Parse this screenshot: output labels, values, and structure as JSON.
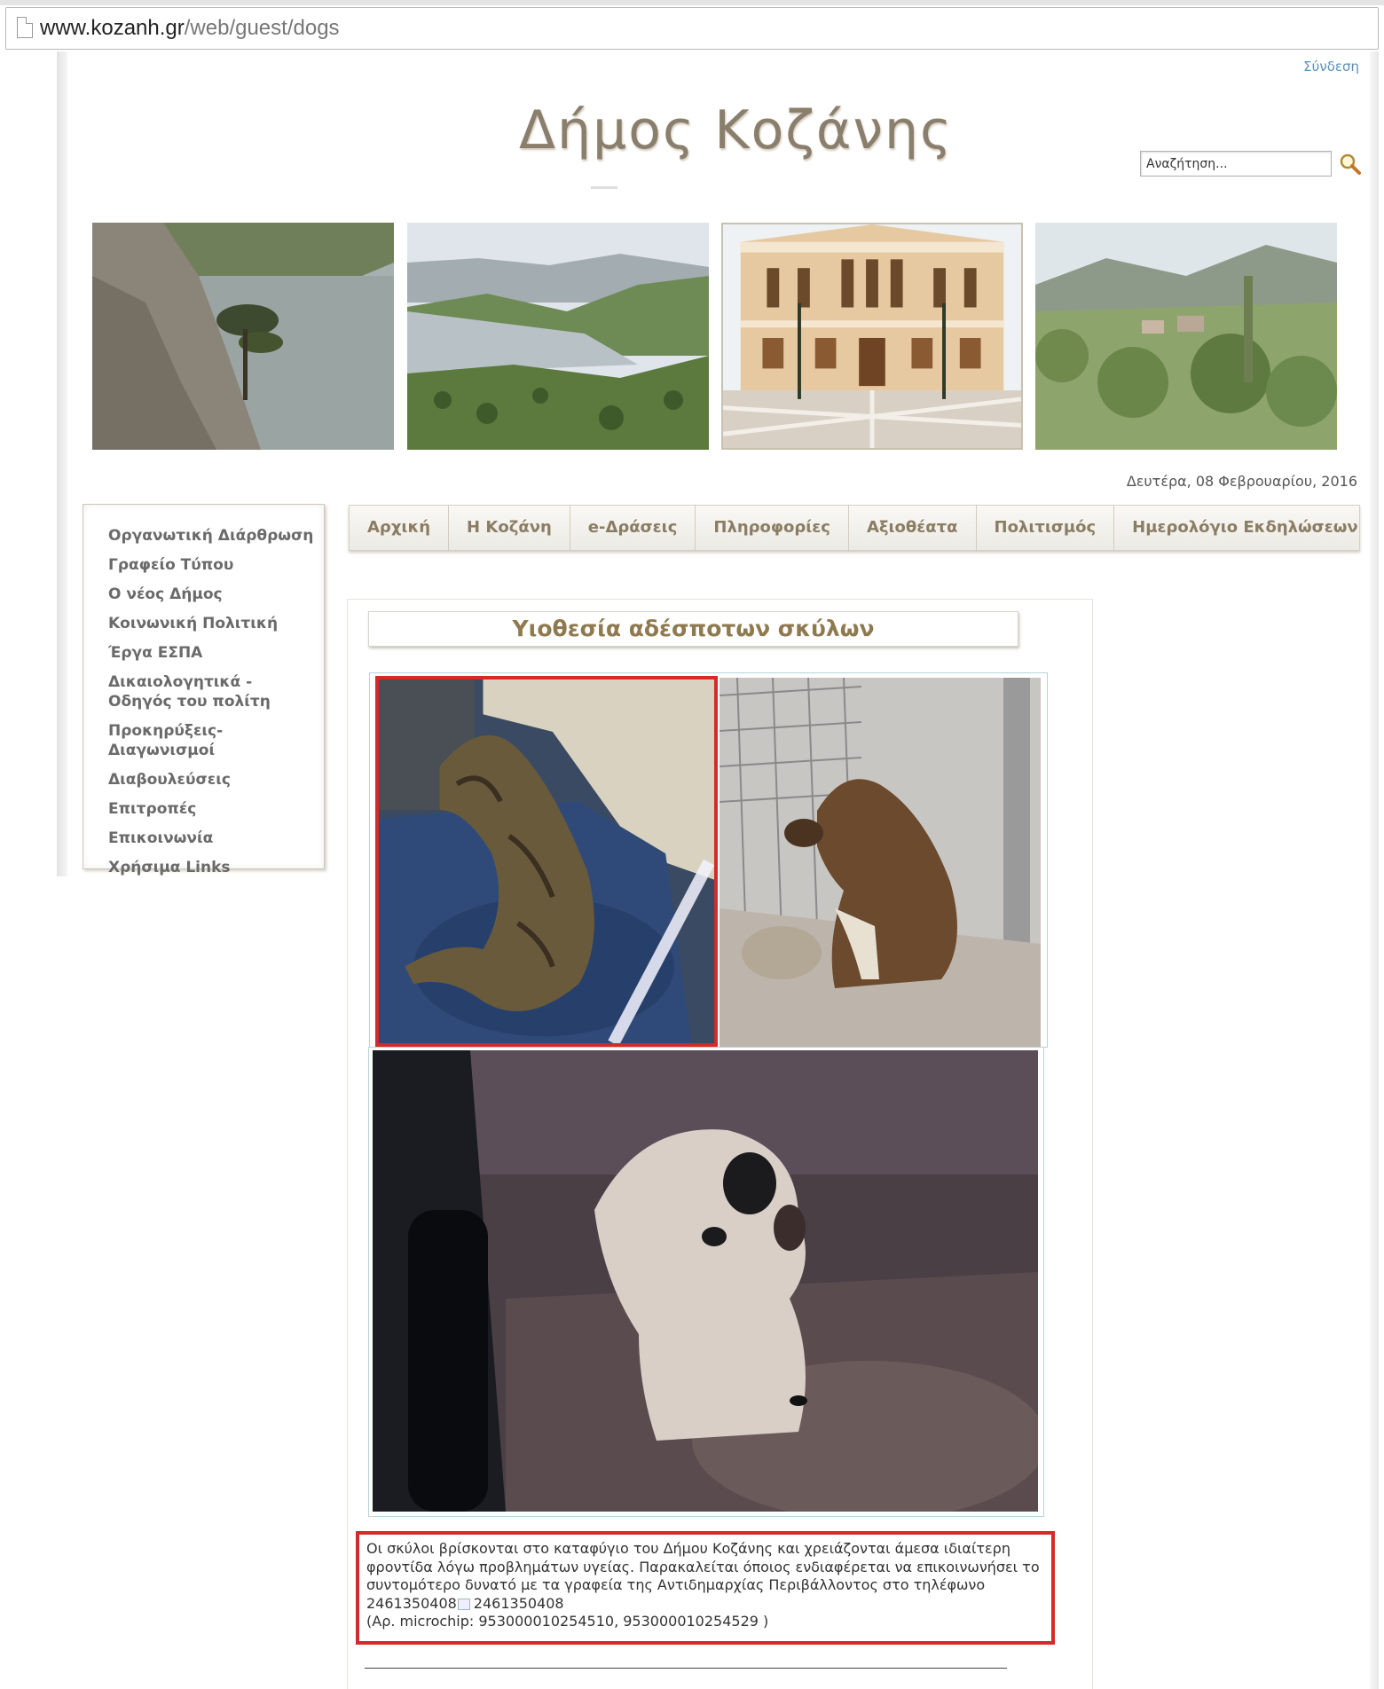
{
  "browser": {
    "url_host": "www.kozanh.gr",
    "url_path": "/web/guest/dogs"
  },
  "header": {
    "login_label": "Σύνδεση",
    "site_title": "Δήμος Κοζάνης",
    "search_placeholder": "Αναζήτηση...",
    "date": "Δευτέρα, 08 Φεβρουαρίου, 2016"
  },
  "sidebar": {
    "items": [
      {
        "label": "Οργανωτική Διάρθρωση"
      },
      {
        "label": "Γραφείο Τύπου"
      },
      {
        "label": "Ο νέος Δήμος"
      },
      {
        "label": "Κοινωνική Πολιτική"
      },
      {
        "label": "Έργα ΕΣΠΑ"
      },
      {
        "label": "Δικαιολογητικά - Οδηγός του πολίτη"
      },
      {
        "label": "Προκηρύξεις-Διαγωνισμοί"
      },
      {
        "label": "Διαβουλεύσεις"
      },
      {
        "label": "Επιτροπές"
      },
      {
        "label": "Επικοινωνία"
      },
      {
        "label": "Χρήσιμα Links"
      }
    ]
  },
  "nav": {
    "items": [
      {
        "label": "Αρχική"
      },
      {
        "label": "Η Κοζάνη"
      },
      {
        "label": "e-Δράσεις"
      },
      {
        "label": "Πληροφορίες"
      },
      {
        "label": "Αξιοθέατα"
      },
      {
        "label": "Πολιτισμός"
      },
      {
        "label": "Ημερολόγιο Εκδηλώσεων"
      }
    ]
  },
  "main": {
    "heading": "Υιοθεσία αδέσποτων σκύλων",
    "info_line1": "Οι σκύλοι βρίσκονται στο καταφύγιο του Δήμου Κοζάνης και χρειάζονται άμεσα ιδιαίτερη",
    "info_line2": "φροντίδα λόγω προβλημάτων υγείας. Παρακαλείται όποιος ενδιαφέρεται να επικοινωνήσει το",
    "info_line3": "συντομότερο δυνατό με τα γραφεία της Αντιδημαρχίας Περιβάλλοντος στο τηλέφωνο",
    "phone_1": "2461350408",
    "phone_2": "2461350408",
    "microchip_line": "(Αρ. microchip: 953000010254510, 953000010254529 )"
  },
  "colors": {
    "accent_red": "#d52a2a",
    "menu_text": "#6a6a6a",
    "nav_text": "#8b7d63",
    "link_blue": "#5f8fb5"
  }
}
